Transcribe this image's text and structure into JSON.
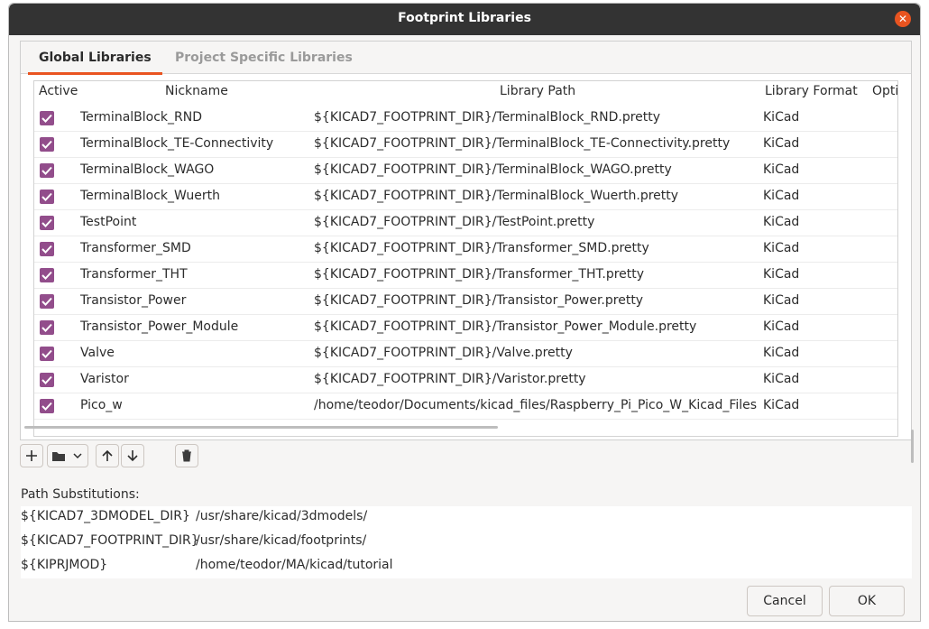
{
  "window": {
    "title": "Footprint Libraries"
  },
  "tabs": [
    {
      "label": "Global Libraries"
    },
    {
      "label": "Project Specific Libraries"
    }
  ],
  "columns": {
    "active": "Active",
    "nickname": "Nickname",
    "path": "Library Path",
    "format": "Library Format",
    "options": "Options"
  },
  "libraries": [
    {
      "nickname": "TerminalBlock_RND",
      "path": "${KICAD7_FOOTPRINT_DIR}/TerminalBlock_RND.pretty",
      "format": "KiCad"
    },
    {
      "nickname": "TerminalBlock_TE-Connectivity",
      "path": "${KICAD7_FOOTPRINT_DIR}/TerminalBlock_TE-Connectivity.pretty",
      "format": "KiCad"
    },
    {
      "nickname": "TerminalBlock_WAGO",
      "path": "${KICAD7_FOOTPRINT_DIR}/TerminalBlock_WAGO.pretty",
      "format": "KiCad"
    },
    {
      "nickname": "TerminalBlock_Wuerth",
      "path": "${KICAD7_FOOTPRINT_DIR}/TerminalBlock_Wuerth.pretty",
      "format": "KiCad"
    },
    {
      "nickname": "TestPoint",
      "path": "${KICAD7_FOOTPRINT_DIR}/TestPoint.pretty",
      "format": "KiCad"
    },
    {
      "nickname": "Transformer_SMD",
      "path": "${KICAD7_FOOTPRINT_DIR}/Transformer_SMD.pretty",
      "format": "KiCad"
    },
    {
      "nickname": "Transformer_THT",
      "path": "${KICAD7_FOOTPRINT_DIR}/Transformer_THT.pretty",
      "format": "KiCad"
    },
    {
      "nickname": "Transistor_Power",
      "path": "${KICAD7_FOOTPRINT_DIR}/Transistor_Power.pretty",
      "format": "KiCad"
    },
    {
      "nickname": "Transistor_Power_Module",
      "path": "${KICAD7_FOOTPRINT_DIR}/Transistor_Power_Module.pretty",
      "format": "KiCad"
    },
    {
      "nickname": "Valve",
      "path": "${KICAD7_FOOTPRINT_DIR}/Valve.pretty",
      "format": "KiCad"
    },
    {
      "nickname": "Varistor",
      "path": "${KICAD7_FOOTPRINT_DIR}/Varistor.pretty",
      "format": "KiCad"
    },
    {
      "nickname": "Pico_w",
      "path": "/home/teodor/Documents/kicad_files/Raspberry_Pi_Pico_W_Kicad_Files",
      "format": "KiCad"
    }
  ],
  "substitutions": {
    "label": "Path Substitutions:",
    "rows": [
      {
        "name": "${KICAD7_3DMODEL_DIR}",
        "value": "/usr/share/kicad/3dmodels/"
      },
      {
        "name": "${KICAD7_FOOTPRINT_DIR}",
        "value": "/usr/share/kicad/footprints/"
      },
      {
        "name": "${KIPRJMOD}",
        "value": "/home/teodor/MA/kicad/tutorial"
      }
    ]
  },
  "buttons": {
    "cancel": "Cancel",
    "ok": "OK"
  },
  "colors": {
    "accent": "#e95420",
    "checkbox": "#924d8b",
    "titlebar": "#333333"
  }
}
